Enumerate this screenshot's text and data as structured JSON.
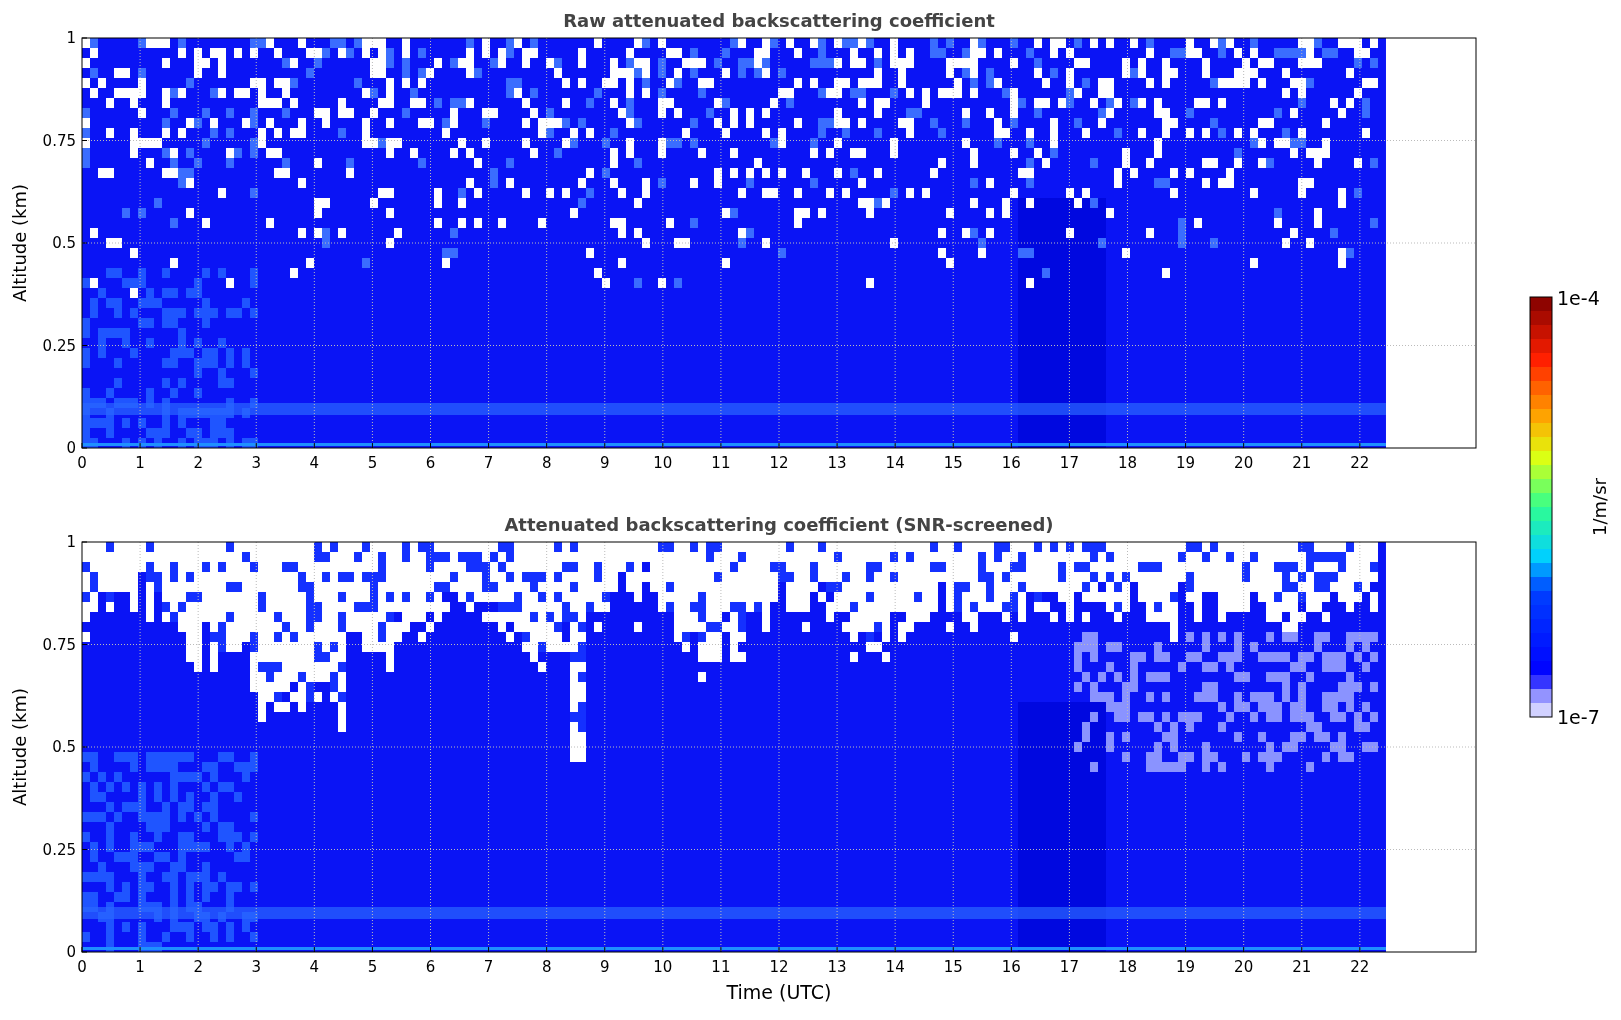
{
  "panels": [
    {
      "title": "Raw attenuated backscattering coefficient",
      "kind": "raw",
      "ylabel": "Altitude (km)",
      "yticks": [
        "1",
        "0.75",
        "0.5",
        "0.25",
        "0"
      ],
      "xticks": [
        "0",
        "1",
        "2",
        "3",
        "4",
        "5",
        "6",
        "7",
        "8",
        "9",
        "10",
        "11",
        "12",
        "13",
        "14",
        "15",
        "16",
        "17",
        "18",
        "19",
        "20",
        "21",
        "22"
      ]
    },
    {
      "title": "Attenuated backscattering coefficient (SNR-screened)",
      "kind": "screened",
      "ylabel": "Altitude (km)",
      "yticks": [
        "1",
        "0.75",
        "0.5",
        "0.25",
        "0"
      ],
      "xticks": [
        "0",
        "1",
        "2",
        "3",
        "4",
        "5",
        "6",
        "7",
        "8",
        "9",
        "10",
        "11",
        "12",
        "13",
        "14",
        "15",
        "16",
        "17",
        "18",
        "19",
        "20",
        "21",
        "22"
      ],
      "xlabel": "Time (UTC)"
    }
  ],
  "colorbar": {
    "max_label": "1e-4",
    "min_label": "1e-7",
    "label": "1/m/sr"
  }
}
